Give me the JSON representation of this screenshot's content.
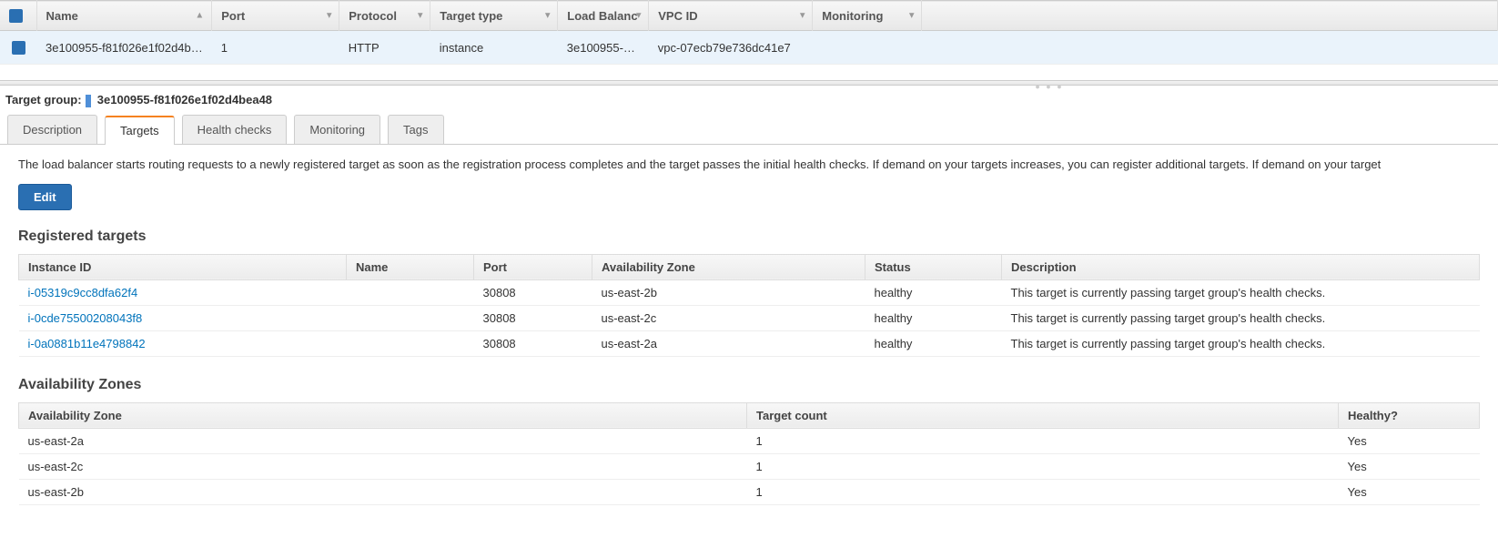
{
  "topTable": {
    "headers": {
      "name": "Name",
      "port": "Port",
      "protocol": "Protocol",
      "targetType": "Target type",
      "loadBalancer": "Load Balanc",
      "vpcId": "VPC ID",
      "monitoring": "Monitoring"
    },
    "row": {
      "name": "3e100955-f81f026e1f02d4b…",
      "port": "1",
      "protocol": "HTTP",
      "targetType": "instance",
      "loadBalancer": "3e100955-…",
      "vpcId": "vpc-07ecb79e736dc41e7",
      "monitoring": ""
    }
  },
  "detail": {
    "label": "Target group:",
    "value": "3e100955-f81f026e1f02d4bea48"
  },
  "tabs": {
    "description": "Description",
    "targets": "Targets",
    "healthChecks": "Health checks",
    "monitoring": "Monitoring",
    "tags": "Tags"
  },
  "panel": {
    "helpText": "The load balancer starts routing requests to a newly registered target as soon as the registration process completes and the target passes the initial health checks. If demand on your targets increases, you can register additional targets. If demand on your target",
    "editLabel": "Edit",
    "registeredTitle": "Registered targets",
    "azTitle": "Availability Zones"
  },
  "registered": {
    "headers": {
      "instanceId": "Instance ID",
      "name": "Name",
      "port": "Port",
      "az": "Availability Zone",
      "status": "Status",
      "description": "Description"
    },
    "rows": [
      {
        "instanceId": "i-05319c9cc8dfa62f4",
        "name": "",
        "port": "30808",
        "az": "us-east-2b",
        "status": "healthy",
        "description": "This target is currently passing target group's health checks."
      },
      {
        "instanceId": "i-0cde75500208043f8",
        "name": "",
        "port": "30808",
        "az": "us-east-2c",
        "status": "healthy",
        "description": "This target is currently passing target group's health checks."
      },
      {
        "instanceId": "i-0a0881b11e4798842",
        "name": "",
        "port": "30808",
        "az": "us-east-2a",
        "status": "healthy",
        "description": "This target is currently passing target group's health checks."
      }
    ]
  },
  "azTable": {
    "headers": {
      "zone": "Availability Zone",
      "count": "Target count",
      "healthy": "Healthy?"
    },
    "rows": [
      {
        "zone": "us-east-2a",
        "count": "1",
        "healthy": "Yes"
      },
      {
        "zone": "us-east-2c",
        "count": "1",
        "healthy": "Yes"
      },
      {
        "zone": "us-east-2b",
        "count": "1",
        "healthy": "Yes"
      }
    ]
  }
}
